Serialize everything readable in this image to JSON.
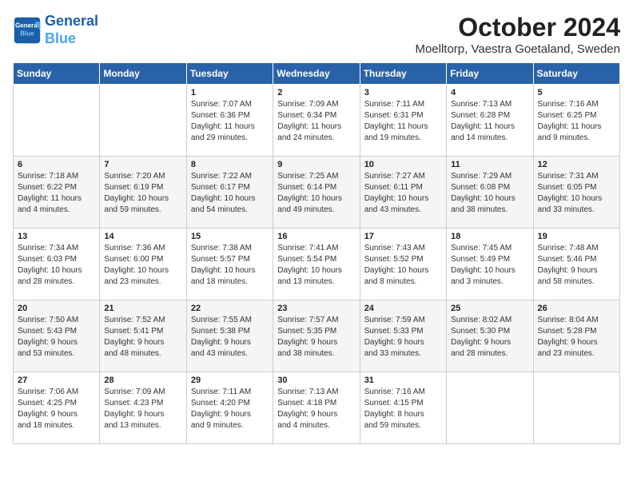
{
  "header": {
    "title": "October 2024",
    "subtitle": "Moelltorp, Vaestra Goetaland, Sweden",
    "logo_general": "General",
    "logo_blue": "Blue"
  },
  "columns": [
    "Sunday",
    "Monday",
    "Tuesday",
    "Wednesday",
    "Thursday",
    "Friday",
    "Saturday"
  ],
  "weeks": [
    [
      {
        "day": "",
        "lines": []
      },
      {
        "day": "",
        "lines": []
      },
      {
        "day": "1",
        "lines": [
          "Sunrise: 7:07 AM",
          "Sunset: 6:36 PM",
          "Daylight: 11 hours",
          "and 29 minutes."
        ]
      },
      {
        "day": "2",
        "lines": [
          "Sunrise: 7:09 AM",
          "Sunset: 6:34 PM",
          "Daylight: 11 hours",
          "and 24 minutes."
        ]
      },
      {
        "day": "3",
        "lines": [
          "Sunrise: 7:11 AM",
          "Sunset: 6:31 PM",
          "Daylight: 11 hours",
          "and 19 minutes."
        ]
      },
      {
        "day": "4",
        "lines": [
          "Sunrise: 7:13 AM",
          "Sunset: 6:28 PM",
          "Daylight: 11 hours",
          "and 14 minutes."
        ]
      },
      {
        "day": "5",
        "lines": [
          "Sunrise: 7:16 AM",
          "Sunset: 6:25 PM",
          "Daylight: 11 hours",
          "and 9 minutes."
        ]
      }
    ],
    [
      {
        "day": "6",
        "lines": [
          "Sunrise: 7:18 AM",
          "Sunset: 6:22 PM",
          "Daylight: 11 hours",
          "and 4 minutes."
        ]
      },
      {
        "day": "7",
        "lines": [
          "Sunrise: 7:20 AM",
          "Sunset: 6:19 PM",
          "Daylight: 10 hours",
          "and 59 minutes."
        ]
      },
      {
        "day": "8",
        "lines": [
          "Sunrise: 7:22 AM",
          "Sunset: 6:17 PM",
          "Daylight: 10 hours",
          "and 54 minutes."
        ]
      },
      {
        "day": "9",
        "lines": [
          "Sunrise: 7:25 AM",
          "Sunset: 6:14 PM",
          "Daylight: 10 hours",
          "and 49 minutes."
        ]
      },
      {
        "day": "10",
        "lines": [
          "Sunrise: 7:27 AM",
          "Sunset: 6:11 PM",
          "Daylight: 10 hours",
          "and 43 minutes."
        ]
      },
      {
        "day": "11",
        "lines": [
          "Sunrise: 7:29 AM",
          "Sunset: 6:08 PM",
          "Daylight: 10 hours",
          "and 38 minutes."
        ]
      },
      {
        "day": "12",
        "lines": [
          "Sunrise: 7:31 AM",
          "Sunset: 6:05 PM",
          "Daylight: 10 hours",
          "and 33 minutes."
        ]
      }
    ],
    [
      {
        "day": "13",
        "lines": [
          "Sunrise: 7:34 AM",
          "Sunset: 6:03 PM",
          "Daylight: 10 hours",
          "and 28 minutes."
        ]
      },
      {
        "day": "14",
        "lines": [
          "Sunrise: 7:36 AM",
          "Sunset: 6:00 PM",
          "Daylight: 10 hours",
          "and 23 minutes."
        ]
      },
      {
        "day": "15",
        "lines": [
          "Sunrise: 7:38 AM",
          "Sunset: 5:57 PM",
          "Daylight: 10 hours",
          "and 18 minutes."
        ]
      },
      {
        "day": "16",
        "lines": [
          "Sunrise: 7:41 AM",
          "Sunset: 5:54 PM",
          "Daylight: 10 hours",
          "and 13 minutes."
        ]
      },
      {
        "day": "17",
        "lines": [
          "Sunrise: 7:43 AM",
          "Sunset: 5:52 PM",
          "Daylight: 10 hours",
          "and 8 minutes."
        ]
      },
      {
        "day": "18",
        "lines": [
          "Sunrise: 7:45 AM",
          "Sunset: 5:49 PM",
          "Daylight: 10 hours",
          "and 3 minutes."
        ]
      },
      {
        "day": "19",
        "lines": [
          "Sunrise: 7:48 AM",
          "Sunset: 5:46 PM",
          "Daylight: 9 hours",
          "and 58 minutes."
        ]
      }
    ],
    [
      {
        "day": "20",
        "lines": [
          "Sunrise: 7:50 AM",
          "Sunset: 5:43 PM",
          "Daylight: 9 hours",
          "and 53 minutes."
        ]
      },
      {
        "day": "21",
        "lines": [
          "Sunrise: 7:52 AM",
          "Sunset: 5:41 PM",
          "Daylight: 9 hours",
          "and 48 minutes."
        ]
      },
      {
        "day": "22",
        "lines": [
          "Sunrise: 7:55 AM",
          "Sunset: 5:38 PM",
          "Daylight: 9 hours",
          "and 43 minutes."
        ]
      },
      {
        "day": "23",
        "lines": [
          "Sunrise: 7:57 AM",
          "Sunset: 5:35 PM",
          "Daylight: 9 hours",
          "and 38 minutes."
        ]
      },
      {
        "day": "24",
        "lines": [
          "Sunrise: 7:59 AM",
          "Sunset: 5:33 PM",
          "Daylight: 9 hours",
          "and 33 minutes."
        ]
      },
      {
        "day": "25",
        "lines": [
          "Sunrise: 8:02 AM",
          "Sunset: 5:30 PM",
          "Daylight: 9 hours",
          "and 28 minutes."
        ]
      },
      {
        "day": "26",
        "lines": [
          "Sunrise: 8:04 AM",
          "Sunset: 5:28 PM",
          "Daylight: 9 hours",
          "and 23 minutes."
        ]
      }
    ],
    [
      {
        "day": "27",
        "lines": [
          "Sunrise: 7:06 AM",
          "Sunset: 4:25 PM",
          "Daylight: 9 hours",
          "and 18 minutes."
        ]
      },
      {
        "day": "28",
        "lines": [
          "Sunrise: 7:09 AM",
          "Sunset: 4:23 PM",
          "Daylight: 9 hours",
          "and 13 minutes."
        ]
      },
      {
        "day": "29",
        "lines": [
          "Sunrise: 7:11 AM",
          "Sunset: 4:20 PM",
          "Daylight: 9 hours",
          "and 9 minutes."
        ]
      },
      {
        "day": "30",
        "lines": [
          "Sunrise: 7:13 AM",
          "Sunset: 4:18 PM",
          "Daylight: 9 hours",
          "and 4 minutes."
        ]
      },
      {
        "day": "31",
        "lines": [
          "Sunrise: 7:16 AM",
          "Sunset: 4:15 PM",
          "Daylight: 8 hours",
          "and 59 minutes."
        ]
      },
      {
        "day": "",
        "lines": []
      },
      {
        "day": "",
        "lines": []
      }
    ]
  ]
}
